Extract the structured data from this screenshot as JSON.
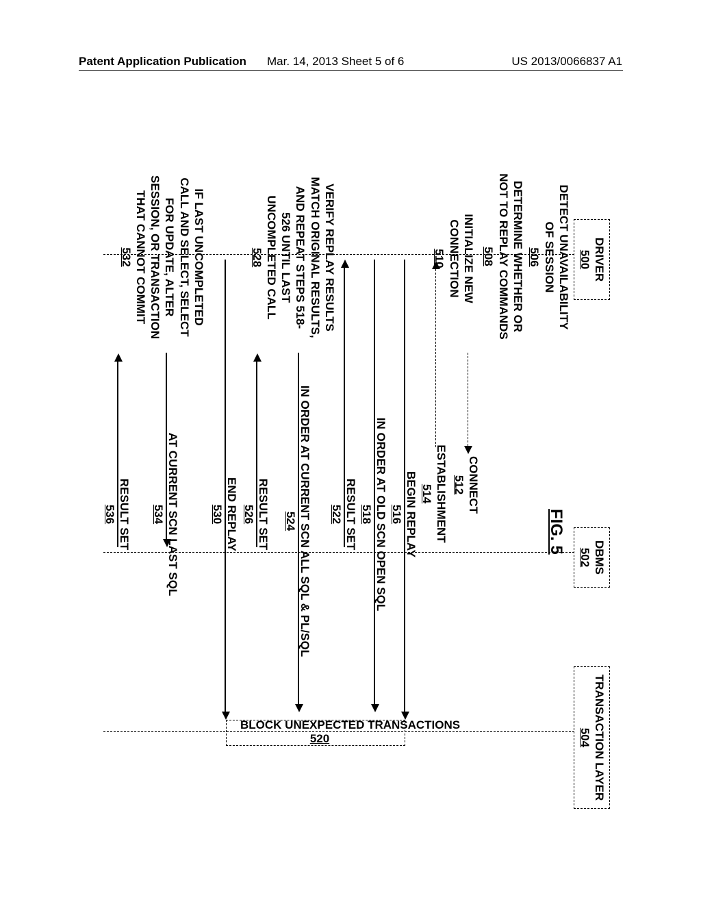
{
  "header": {
    "left": "Patent Application Publication",
    "center": "Mar. 14, 2013  Sheet 5 of 6",
    "right": "US 2013/0066837 A1"
  },
  "fig_label": "FIG. 5",
  "columns": {
    "driver": {
      "title": "DRIVER",
      "ref": "500"
    },
    "dbms": {
      "title": "DBMS",
      "ref": "502"
    },
    "transaction": {
      "title": "TRANSACTION LAYER",
      "ref": "504"
    }
  },
  "driver_steps": {
    "detect": {
      "text": "DETECT UNAVAILABILITY OF SESSION",
      "ref": "506"
    },
    "determine": {
      "text": "DETERMINE WHETHER OR NOT TO REPLAY COMMANDS",
      "ref": "508"
    },
    "init": {
      "text": "INITIALIZE NEW CONNECTION",
      "ref": "510"
    },
    "verify": {
      "text": "VERIFY REPLAY RESULTS MATCH ORIGINAL RESULTS, AND REPEAT STEPS 518-526 UNTIL LAST UNCOMPLETED CALL",
      "ref": "528"
    },
    "lastcall": {
      "text": "IF LAST UNCOMPLETED CALL AND SELECT, SELECT FOR UPDATE, ALTER SESSION, OR TRANSACTION THAT CANNOT COMMIT",
      "ref": "532"
    }
  },
  "messages": {
    "connect": {
      "text": "CONNECT",
      "ref": "512"
    },
    "establishment": {
      "text": "ESTABLISHMENT",
      "ref": "514"
    },
    "begin_replay": {
      "text": "BEGIN REPLAY",
      "ref": "516"
    },
    "in_order_open": {
      "text": "IN ORDER AT OLD SCN OPEN SQL",
      "ref": "518"
    },
    "result_set_1": {
      "text": "RESULT SET",
      "ref": "522"
    },
    "in_order_all": {
      "text": "IN ORDER AT CURRENT SCN ALL SQL & PL/SQL",
      "ref": "524"
    },
    "result_set_2": {
      "text": "RESULT SET",
      "ref": "526"
    },
    "end_replay": {
      "text": "END REPLAY",
      "ref": "530"
    },
    "at_current": {
      "text": "AT CURRENT SCN LAST SQL",
      "ref": "534"
    },
    "result_set_3": {
      "text": "RESULT SET",
      "ref": "536"
    }
  },
  "tl_bar": {
    "text": "BLOCK UNEXPECTED TRANSACTIONS",
    "ref": "520"
  }
}
